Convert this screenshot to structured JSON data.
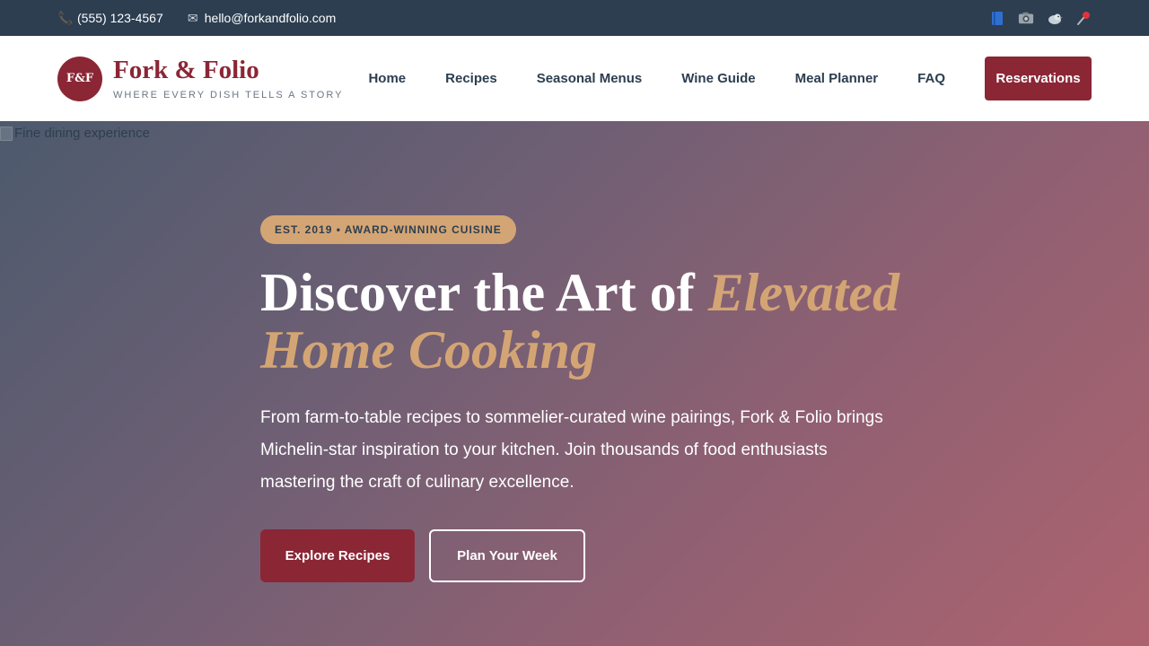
{
  "topbar": {
    "phone": {
      "icon": "phone-icon",
      "glyph": "📞",
      "text": "(555) 123-4567"
    },
    "email": {
      "icon": "envelope-icon",
      "glyph": "✉",
      "text": "hello@forkandfolio.com"
    },
    "social": [
      {
        "icon": "book-icon"
      },
      {
        "icon": "camera-icon"
      },
      {
        "icon": "bird-icon"
      },
      {
        "icon": "pin-icon"
      }
    ]
  },
  "header": {
    "logo_initials": "F&F",
    "brand_name": "Fork & Folio",
    "tagline": "WHERE EVERY DISH TELLS A STORY",
    "nav": [
      "Home",
      "Recipes",
      "Seasonal Menus",
      "Wine Guide",
      "Meal Planner",
      "FAQ"
    ],
    "cta_label": "Reservations"
  },
  "hero": {
    "image_alt": "Fine dining experience",
    "badge": "EST. 2019 • AWARD-WINNING CUISINE",
    "headline_plain": "Discover the Art of ",
    "headline_accent": "Elevated Home Cooking",
    "description": "From farm-to-table recipes to sommelier-curated wine pairings, Fork & Folio brings Michelin-star inspiration to your kitchen. Join thousands of food enthusiasts mastering the craft of culinary excellence.",
    "primary_button": "Explore Recipes",
    "secondary_button": "Plan Your Week"
  },
  "colors": {
    "brand": "#8b2635",
    "accent": "#d4a574",
    "dark": "#2c3e50"
  }
}
